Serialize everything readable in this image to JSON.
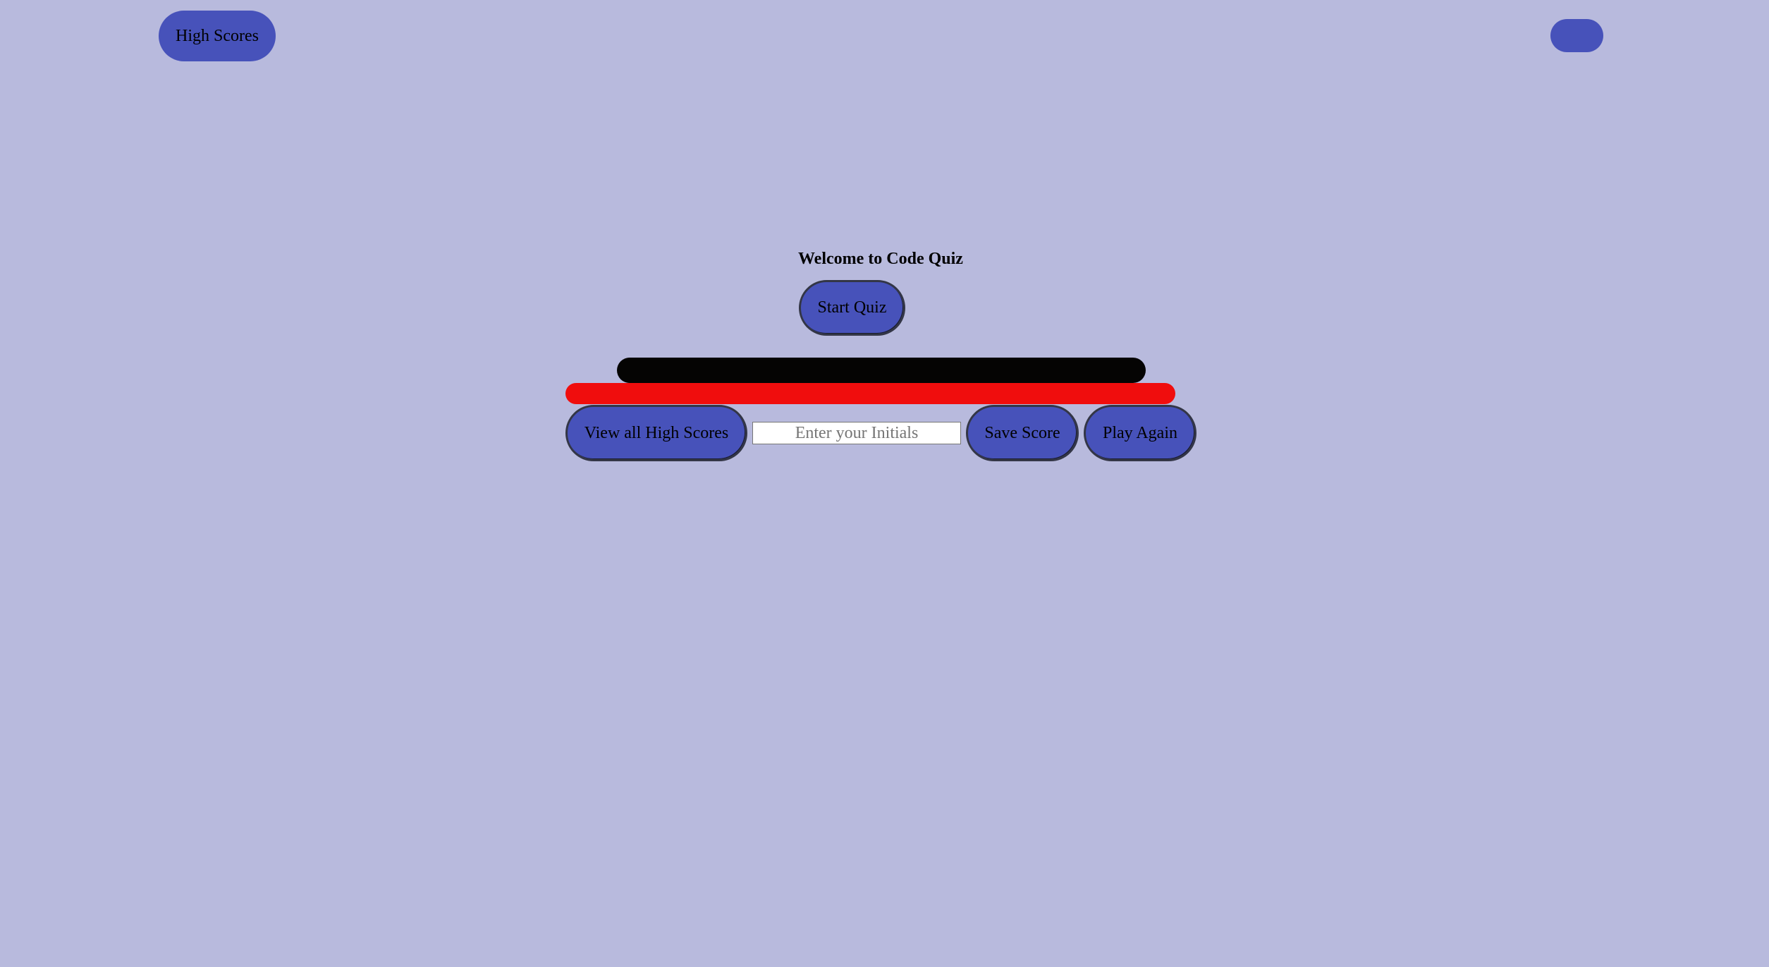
{
  "header": {
    "high_scores_label": "High Scores",
    "timer_text": ""
  },
  "quiz": {
    "title": "Welcome to Code Quiz",
    "start_label": "Start Quiz",
    "question_text": "",
    "feedback_text": ""
  },
  "score_entry": {
    "view_all_label": "View all High Scores",
    "initials_placeholder": "Enter your Initials",
    "initials_value": "",
    "save_label": "Save Score",
    "play_again_label": "Play Again"
  },
  "colors": {
    "background": "#b8badd",
    "button": "#4752ba",
    "question_bar": "#050403",
    "feedback_bar": "#f00d0d"
  }
}
